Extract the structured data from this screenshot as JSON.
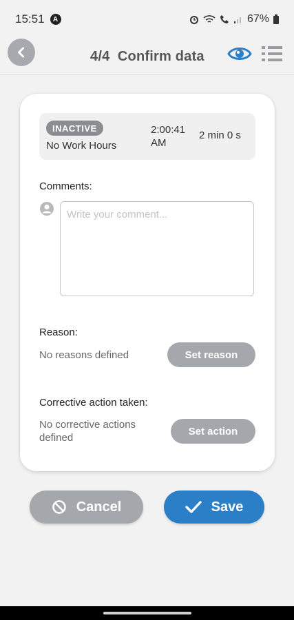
{
  "status_bar": {
    "time": "15:51",
    "app_indicator": "A",
    "battery": "67%"
  },
  "header": {
    "title": "4/4  Confirm data",
    "icons": [
      "back-icon",
      "eye-icon",
      "list-icon"
    ],
    "accent_color": "#2a7fc6"
  },
  "event": {
    "badge": "INACTIVE",
    "label": "No Work Hours",
    "time": "2:00:41 AM",
    "duration": "2 min 0 s"
  },
  "comments": {
    "label": "Comments:",
    "placeholder": "Write your comment...",
    "value": ""
  },
  "reason": {
    "label": "Reason:",
    "empty_text": "No reasons defined",
    "button": "Set reason"
  },
  "corrective": {
    "label": "Corrective action taken:",
    "empty_text": "No corrective actions defined",
    "button": "Set action"
  },
  "actions": {
    "cancel": "Cancel",
    "save": "Save"
  }
}
